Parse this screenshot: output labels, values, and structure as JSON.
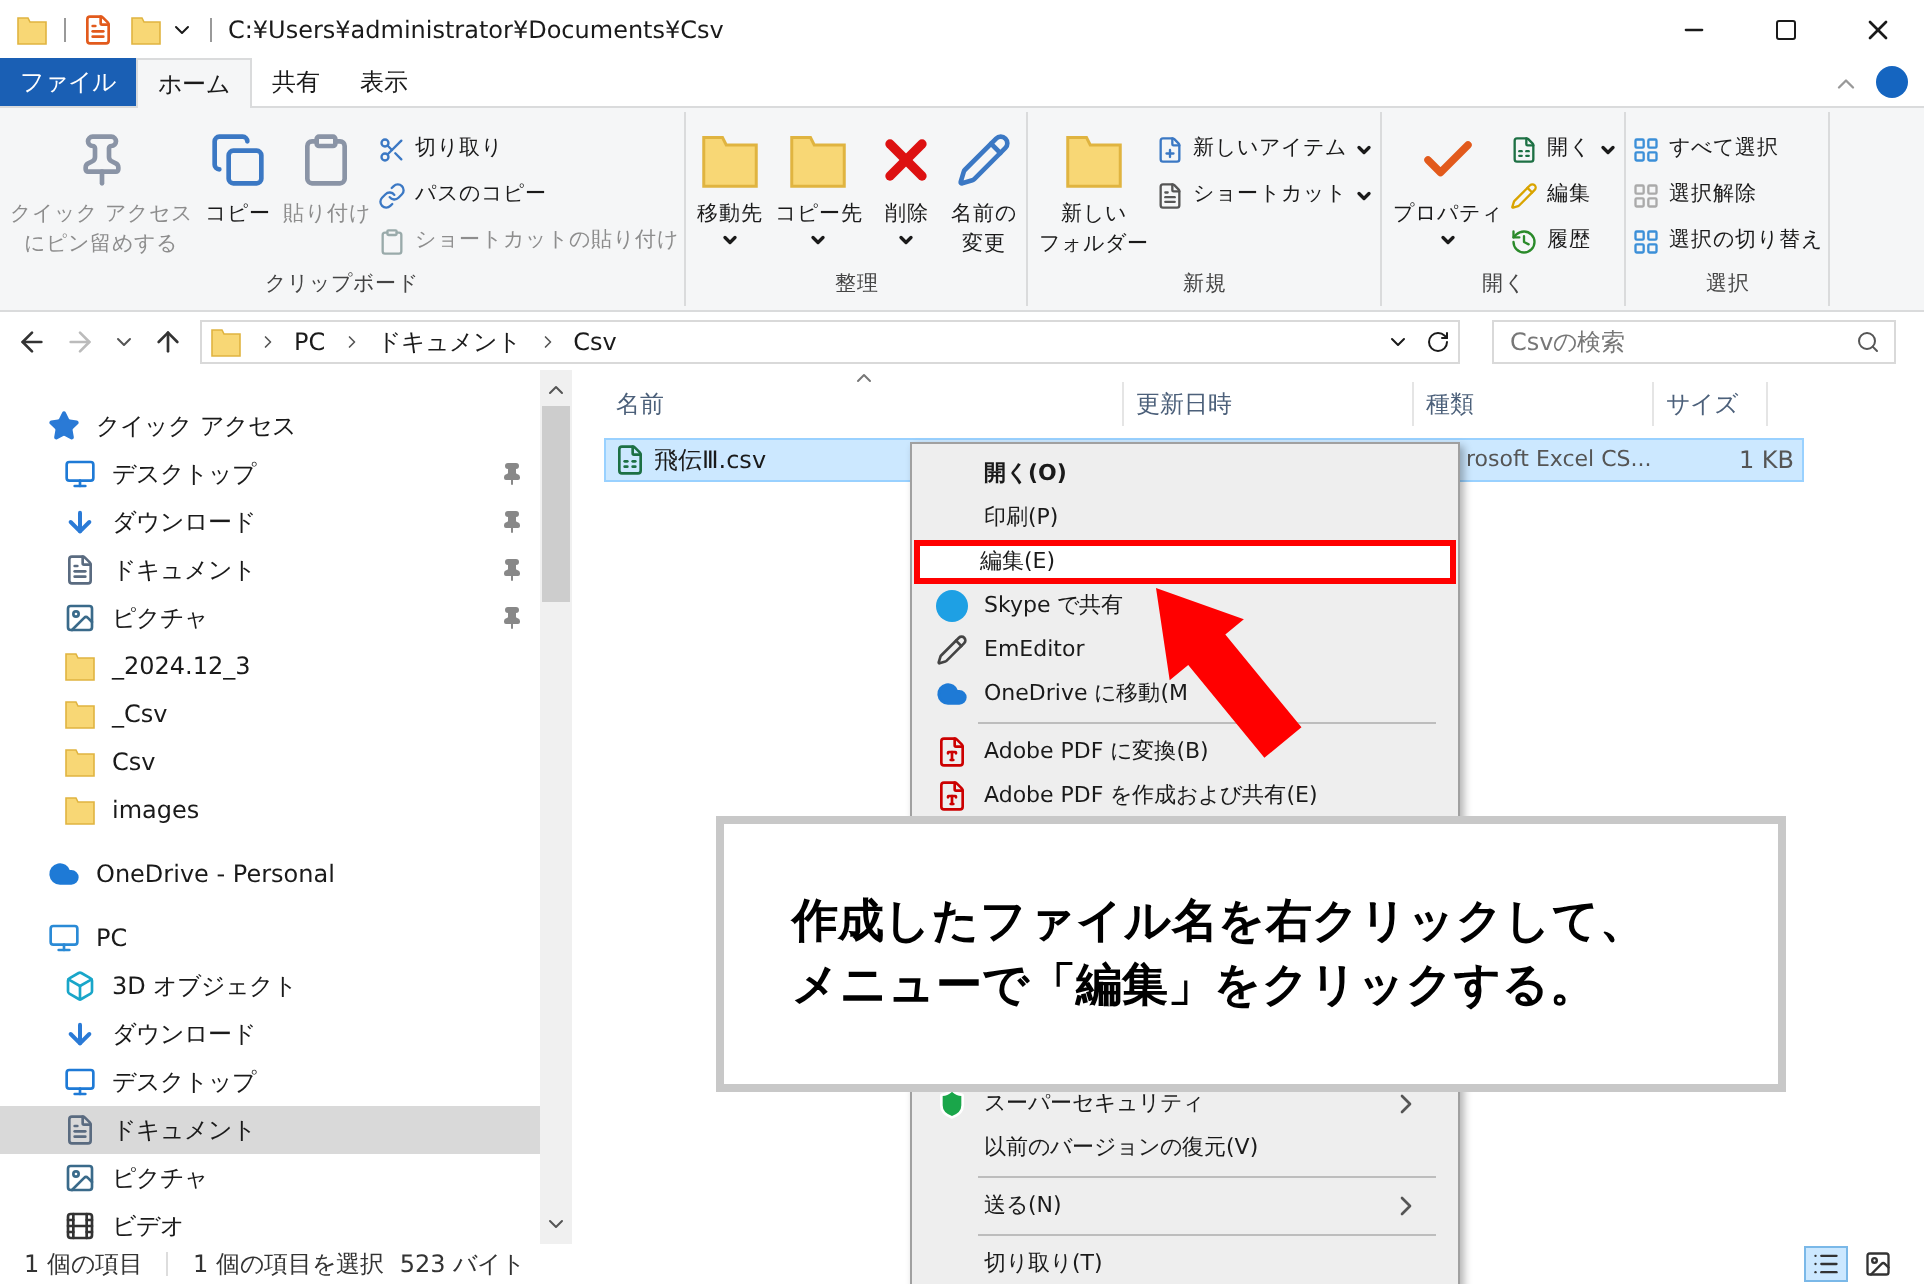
{
  "window": {
    "title": "C:¥Users¥administrator¥Documents¥Csv"
  },
  "ribbon_tabs": [
    {
      "label": "ファイル",
      "kind": "file",
      "selected": false
    },
    {
      "label": "ホーム",
      "kind": "tab",
      "selected": true
    },
    {
      "label": "共有",
      "kind": "tab",
      "selected": false
    },
    {
      "label": "表示",
      "kind": "tab",
      "selected": false
    }
  ],
  "ribbon": {
    "groups": [
      {
        "label": "クリップボード",
        "large": [
          {
            "lines": [
              "クイック アクセス",
              "にピン留めする"
            ],
            "disabled": true,
            "dropdown": false
          },
          {
            "lines": [
              "コピー"
            ],
            "disabled": false,
            "dropdown": false
          },
          {
            "lines": [
              "貼り付け"
            ],
            "disabled": true,
            "dropdown": false
          }
        ],
        "small": [
          {
            "label": "切り取り",
            "disabled": false,
            "dropdown": false
          },
          {
            "label": "パスのコピー",
            "disabled": false,
            "dropdown": false
          },
          {
            "label": "ショートカットの貼り付け",
            "disabled": true,
            "dropdown": false
          }
        ]
      },
      {
        "label": "整理",
        "large": [
          {
            "lines": [
              "移動先"
            ],
            "disabled": false,
            "dropdown": true
          },
          {
            "lines": [
              "コピー先"
            ],
            "disabled": false,
            "dropdown": true
          },
          {
            "lines": [
              "削除"
            ],
            "disabled": false,
            "dropdown": true
          },
          {
            "lines": [
              "名前の",
              "変更"
            ],
            "disabled": false,
            "dropdown": false
          }
        ]
      },
      {
        "label": "新規",
        "large": [
          {
            "lines": [
              "新しい",
              "フォルダー"
            ],
            "disabled": false,
            "dropdown": false
          }
        ],
        "small": [
          {
            "label": "新しいアイテム",
            "disabled": false,
            "dropdown": true
          },
          {
            "label": "ショートカット",
            "disabled": false,
            "dropdown": true
          }
        ]
      },
      {
        "label": "開く",
        "large": [
          {
            "lines": [
              "プロパティ"
            ],
            "disabled": false,
            "dropdown": true
          }
        ],
        "small": [
          {
            "label": "開く",
            "disabled": false,
            "dropdown": true
          },
          {
            "label": "編集",
            "disabled": false,
            "dropdown": false
          },
          {
            "label": "履歴",
            "disabled": false,
            "dropdown": false
          }
        ]
      },
      {
        "label": "選択",
        "small": [
          {
            "label": "すべて選択",
            "disabled": false,
            "dropdown": false
          },
          {
            "label": "選択解除",
            "disabled": false,
            "dropdown": false
          },
          {
            "label": "選択の切り替え",
            "disabled": false,
            "dropdown": false
          }
        ]
      }
    ]
  },
  "address_bar": {
    "path": [
      "PC",
      "ドキュメント",
      "Csv"
    ],
    "search": {
      "placeholder": "Csvの検索"
    }
  },
  "sidebar": {
    "sections": [
      {
        "label": "クイック アクセス",
        "kind": "quick",
        "selected": false,
        "children": [
          {
            "label": "デスクトップ",
            "kind": "desktop",
            "pinned": true,
            "selected": false
          },
          {
            "label": "ダウンロード",
            "kind": "downloads",
            "pinned": true,
            "selected": false
          },
          {
            "label": "ドキュメント",
            "kind": "documents",
            "pinned": true,
            "selected": false
          },
          {
            "label": "ピクチャ",
            "kind": "pictures",
            "pinned": true,
            "selected": false
          },
          {
            "label": "_2024.12_3",
            "kind": "folder",
            "pinned": false,
            "selected": false
          },
          {
            "label": "_Csv",
            "kind": "folder",
            "pinned": false,
            "selected": false
          },
          {
            "label": "Csv",
            "kind": "folder",
            "pinned": false,
            "selected": false
          },
          {
            "label": "images",
            "kind": "folder",
            "pinned": false,
            "selected": false
          }
        ]
      },
      {
        "label": "OneDrive - Personal",
        "kind": "cloud",
        "selected": false
      },
      {
        "label": "PC",
        "kind": "pc",
        "selected": false,
        "children": [
          {
            "label": "3D オブジェクト",
            "kind": "objects",
            "pinned": false,
            "selected": false
          },
          {
            "label": "ダウンロード",
            "kind": "downloads",
            "pinned": false,
            "selected": false
          },
          {
            "label": "デスクトップ",
            "kind": "desktop",
            "pinned": false,
            "selected": false
          },
          {
            "label": "ドキュメント",
            "kind": "documents",
            "pinned": false,
            "selected": true
          },
          {
            "label": "ピクチャ",
            "kind": "pictures",
            "pinned": false,
            "selected": false
          },
          {
            "label": "ビデオ",
            "kind": "videos",
            "pinned": false,
            "selected": false
          }
        ]
      }
    ]
  },
  "file_list": {
    "columns": [
      {
        "label": "名前",
        "sorted": true
      },
      {
        "label": "更新日時",
        "sorted": false
      },
      {
        "label": "種類",
        "sorted": false
      },
      {
        "label": "サイズ",
        "sorted": false
      }
    ],
    "rows": [
      {
        "name": "飛伝Ⅲ.csv",
        "type": "rosoft Excel CS...",
        "size": "1 KB",
        "selected": true
      }
    ]
  },
  "context_menu": {
    "sections": [
      [
        {
          "kind": "item",
          "label": "開く(O)",
          "default": true,
          "highlighted": false,
          "submenu": false
        },
        {
          "kind": "item",
          "label": "印刷(P)",
          "default": false,
          "highlighted": false,
          "submenu": false
        },
        {
          "kind": "item",
          "label": "編集(E)",
          "default": false,
          "highlighted": true,
          "submenu": false
        },
        {
          "kind": "item",
          "label": "Skype で共有",
          "default": false,
          "highlighted": false,
          "submenu": false
        },
        {
          "kind": "item",
          "label": "EmEditor",
          "default": false,
          "highlighted": false,
          "submenu": false
        },
        {
          "kind": "item",
          "label": "OneDrive に移動(M",
          "default": false,
          "highlighted": false,
          "submenu": false
        },
        {
          "kind": "separator"
        },
        {
          "kind": "item",
          "label": "Adobe PDF に変換(B)",
          "default": false,
          "highlighted": false,
          "submenu": false
        },
        {
          "kind": "item",
          "label": "Adobe PDF を作成および共有(E)",
          "default": false,
          "highlighted": false,
          "submenu": false
        }
      ],
      [
        {
          "kind": "item",
          "label": "スーパーセキュリティ",
          "default": false,
          "highlighted": false,
          "submenu": true
        },
        {
          "kind": "item",
          "label": "以前のバージョンの復元(V)",
          "default": false,
          "highlighted": false,
          "submenu": false
        },
        {
          "kind": "separator"
        },
        {
          "kind": "item",
          "label": "送る(N)",
          "default": false,
          "highlighted": false,
          "submenu": true
        },
        {
          "kind": "separator"
        },
        {
          "kind": "item",
          "label": "切り取り(T)",
          "default": false,
          "highlighted": false,
          "submenu": false
        }
      ]
    ]
  },
  "callout": {
    "lines": [
      "作成したファイル名を右クリックして、",
      "メニューで「編集」をクリックする。"
    ]
  },
  "status_bar": {
    "items_count": "1 個の項目",
    "selection": "1 個の項目を選択",
    "size": "523 バイト"
  }
}
